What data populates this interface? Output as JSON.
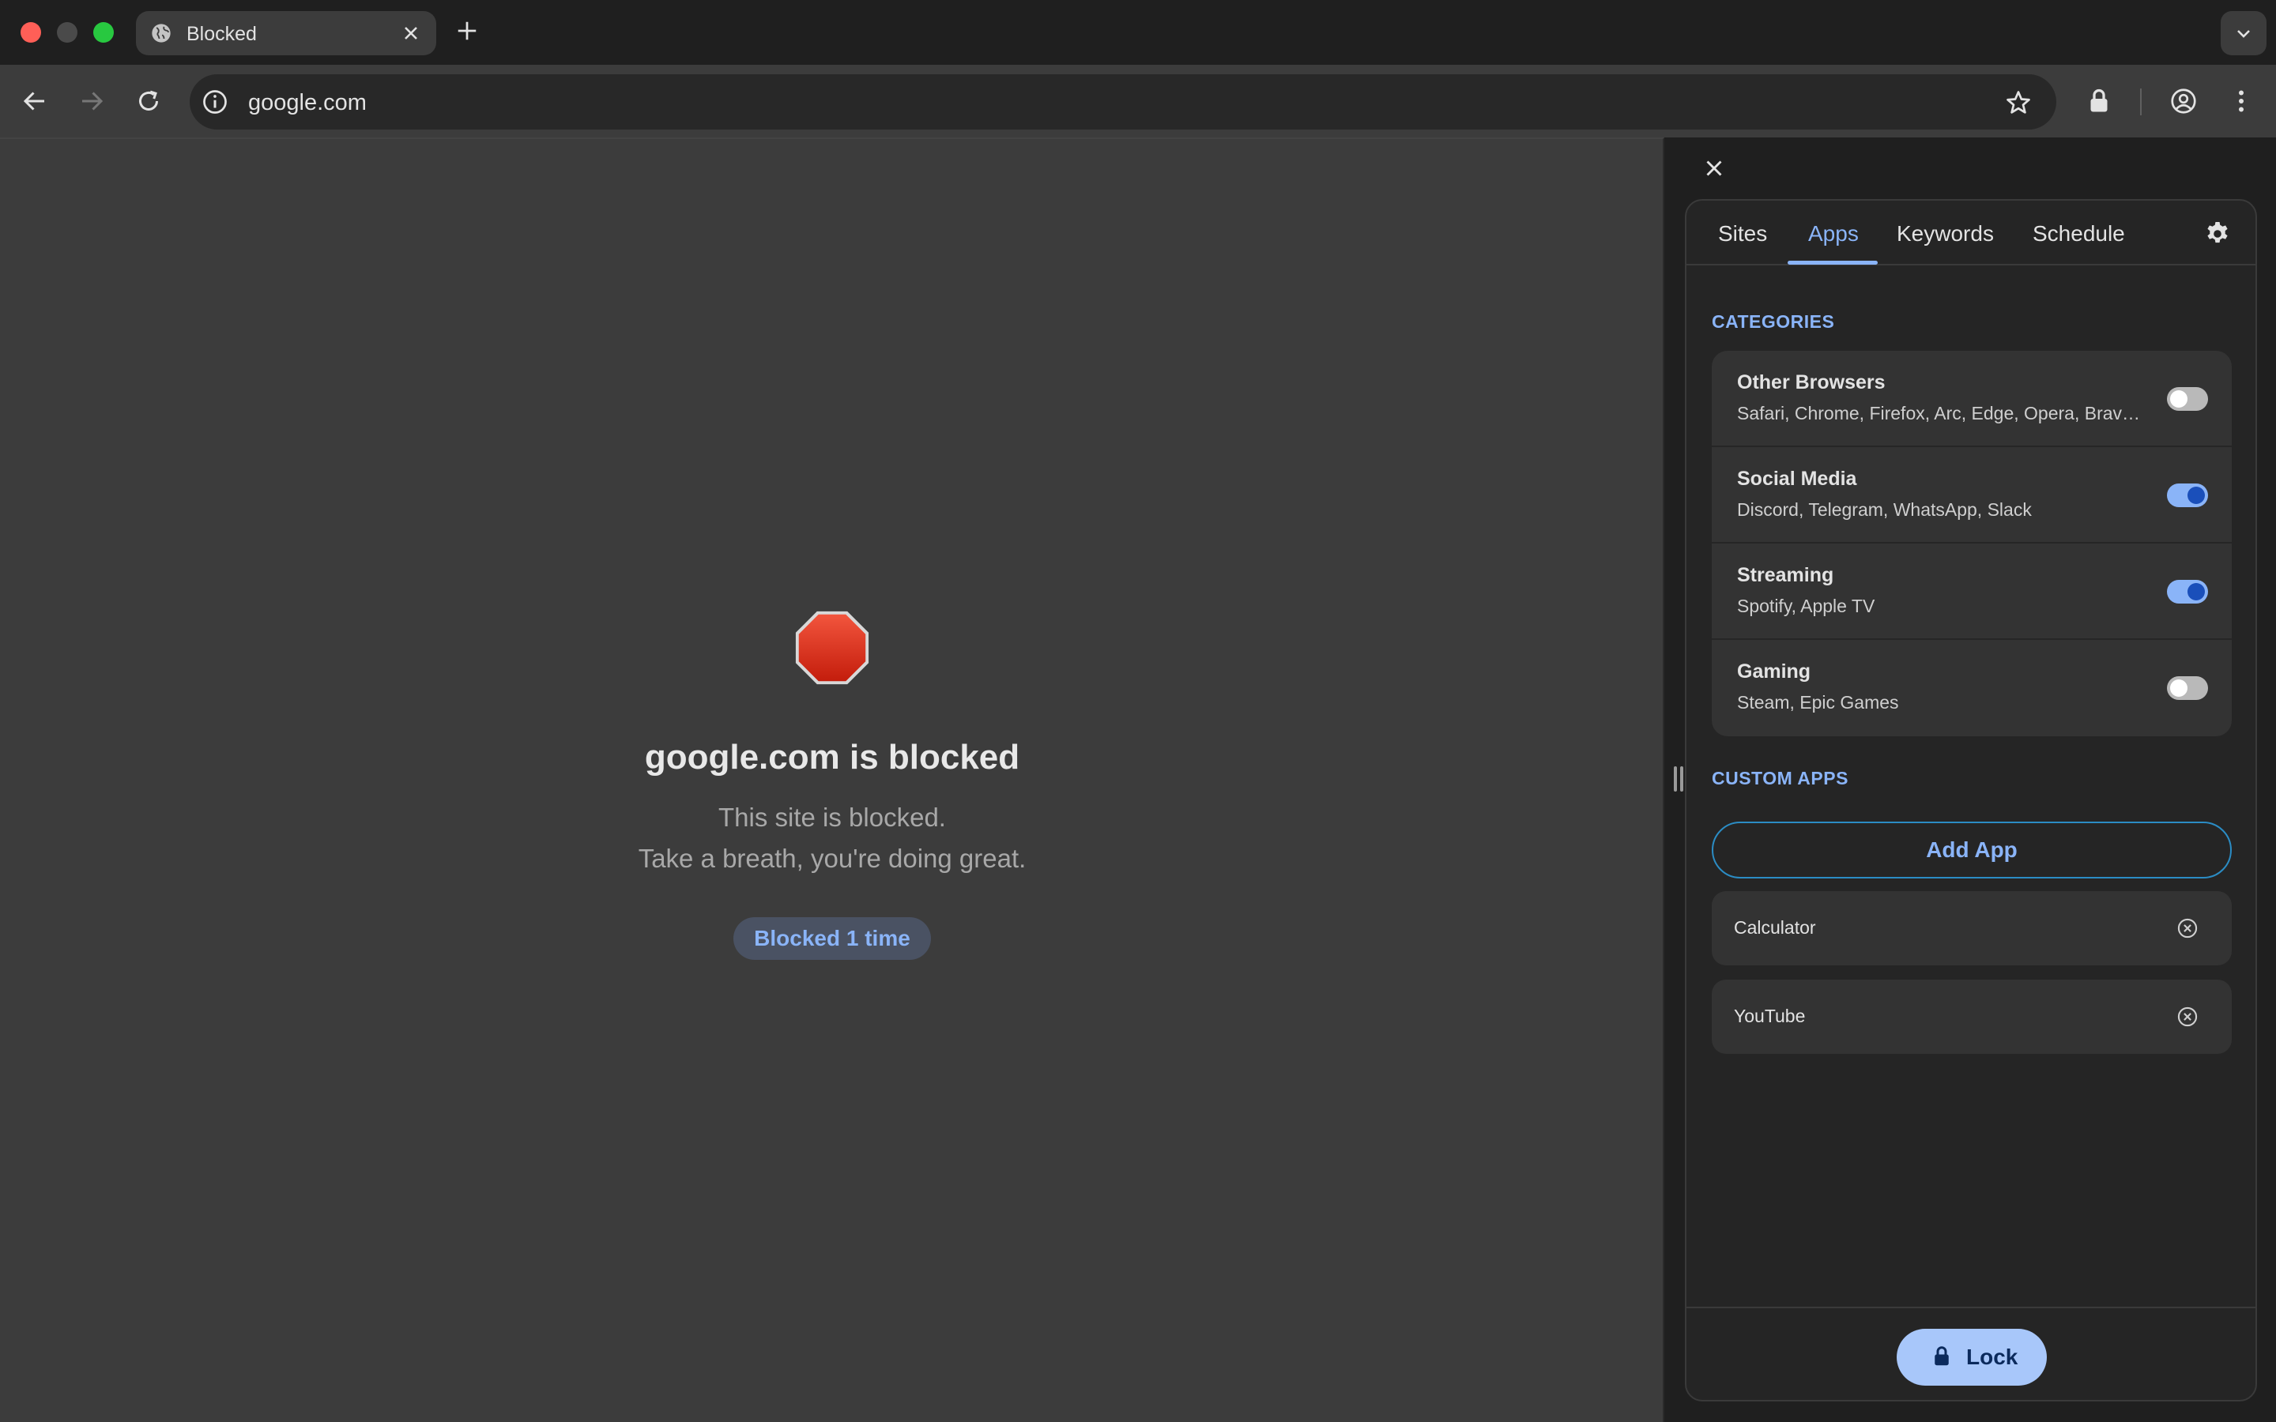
{
  "browser": {
    "tab": {
      "title": "Blocked",
      "favicon": "globe-icon"
    },
    "address_bar": {
      "url": "google.com"
    }
  },
  "blocked_page": {
    "icon": "stop-sign-icon",
    "title": "google.com is blocked",
    "message_line1": "This site is blocked.",
    "message_line2": "Take a breath, you're doing great.",
    "badge": "Blocked 1 time"
  },
  "extension": {
    "tabs": [
      {
        "label": "Sites",
        "active": false
      },
      {
        "label": "Apps",
        "active": true
      },
      {
        "label": "Keywords",
        "active": false
      },
      {
        "label": "Schedule",
        "active": false
      }
    ],
    "categories_title": "CATEGORIES",
    "categories": [
      {
        "name": "Other Browsers",
        "apps": "Safari, Chrome, Firefox, Arc, Edge, Opera, Brave, Vivaldi",
        "enabled": false
      },
      {
        "name": "Social Media",
        "apps": "Discord, Telegram, WhatsApp, Slack",
        "enabled": true
      },
      {
        "name": "Streaming",
        "apps": "Spotify, Apple TV",
        "enabled": true
      },
      {
        "name": "Gaming",
        "apps": "Steam, Epic Games",
        "enabled": false
      }
    ],
    "custom_apps_title": "CUSTOM APPS",
    "add_app_label": "Add App",
    "custom_apps": [
      {
        "name": "Calculator"
      },
      {
        "name": "YouTube"
      }
    ],
    "lock_label": "Lock"
  },
  "colors": {
    "accent": "#8ab4f8",
    "toggle_on": "#8ab4f8",
    "stop_red": "#e0311f",
    "lock_button": "#a8c7fa"
  }
}
